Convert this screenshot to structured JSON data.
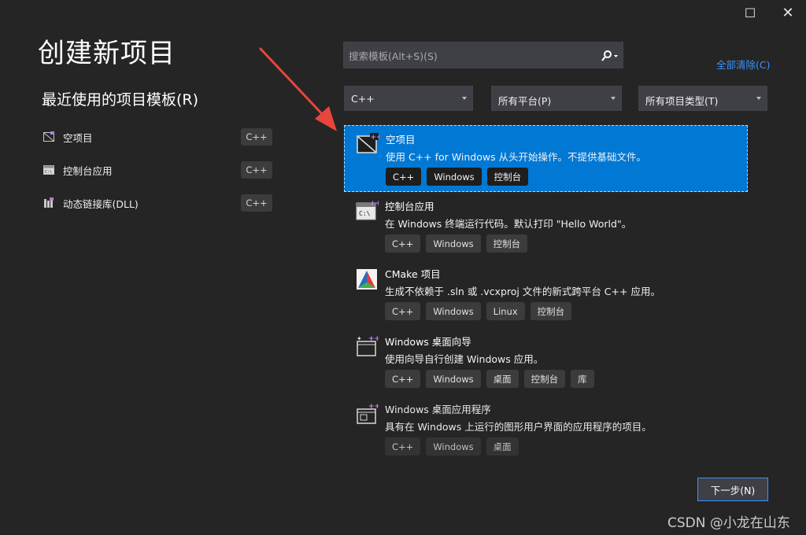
{
  "window": {
    "maximize_glyph": "☐",
    "close_glyph": "✕"
  },
  "page_title": "创建新项目",
  "recent": {
    "title": "最近使用的项目模板(R)",
    "items": [
      {
        "label": "空项目",
        "badge": "C++",
        "icon": "empty-project-icon"
      },
      {
        "label": "控制台应用",
        "badge": "C++",
        "icon": "console-app-icon"
      },
      {
        "label": "动态链接库(DLL)",
        "badge": "C++",
        "icon": "dll-icon"
      }
    ]
  },
  "search": {
    "placeholder": "搜索模板(Alt+S)(S)"
  },
  "clear_all": "全部清除(C)",
  "filters": {
    "language": "C++",
    "platform": "所有平台(P)",
    "project_type": "所有项目类型(T)"
  },
  "templates": [
    {
      "name": "空项目",
      "description": "使用 C++ for Windows 从头开始操作。不提供基础文件。",
      "tags": [
        "C++",
        "Windows",
        "控制台"
      ],
      "selected": true
    },
    {
      "name": "控制台应用",
      "description": "在 Windows 终端运行代码。默认打印 \"Hello World\"。",
      "tags": [
        "C++",
        "Windows",
        "控制台"
      ]
    },
    {
      "name": "CMake 项目",
      "description": "生成不依赖于 .sln 或 .vcxproj 文件的新式跨平台 C++ 应用。",
      "tags": [
        "C++",
        "Windows",
        "Linux",
        "控制台"
      ]
    },
    {
      "name": "Windows 桌面向导",
      "description": "使用向导自行创建 Windows 应用。",
      "tags": [
        "C++",
        "Windows",
        "桌面",
        "控制台",
        "库"
      ]
    },
    {
      "name": "Windows 桌面应用程序",
      "description": "具有在 Windows 上运行的图形用户界面的应用程序的项目。",
      "tags": [
        "C++",
        "Windows",
        "桌面"
      ]
    }
  ],
  "next_button": "下一步(N)",
  "watermark": "CSDN @小龙在山东",
  "colors": {
    "accent": "#0078d4",
    "link": "#3794ff",
    "annotation_arrow": "#e8453c"
  }
}
